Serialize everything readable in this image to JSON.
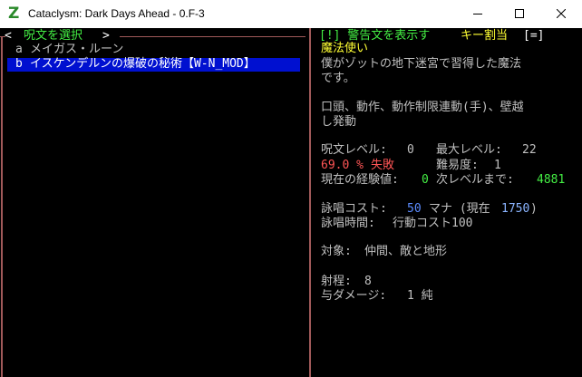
{
  "window": {
    "title": "Cataclysm: Dark Days Ahead - 0.F-3",
    "app_icon": "Z"
  },
  "left_panel": {
    "title": "呪文を選択",
    "open_marker": "<",
    "close_marker": ">",
    "spells": [
      {
        "key": "a",
        "name": "メイガス・ルーン",
        "selected": false
      },
      {
        "key": "b",
        "name": "イスケンデルンの爆破の秘術【W-N_MOD】",
        "selected": true
      }
    ]
  },
  "right_panel": {
    "toggle_label": "[!] 警告文を表示す",
    "keybind_label": "キー割当",
    "keybind_key": "[=]",
    "school": "魔法使い",
    "description": "僕がゾットの地下迷宮で習得した魔法です。",
    "description_lines": [
      "僕がゾットの地下迷宮で習得した魔法",
      "です。"
    ],
    "components_lines": [
      "口頭、動作、動作制限連動(手)、壁越",
      "し発動"
    ],
    "spell_level_label": "呪文レベル:",
    "spell_level": "0",
    "max_level_label": "最大レベル:",
    "max_level": "22",
    "failure_percent": "69.0 %",
    "failure_label": "失敗",
    "difficulty_label": "難易度:",
    "difficulty": "1",
    "exp_label": "現在の経験値:",
    "exp": "0",
    "next_label": "次レベルまで:",
    "next": "4881",
    "cost_label": "詠唱コスト:",
    "cost": "50",
    "cost_unit": "マナ (現在",
    "current_mana": "1750",
    "cost_close": ")",
    "cast_time_label": "詠唱時間:",
    "cast_time": "行動コスト100",
    "target_label": "対象:",
    "target": "仲間、敵と地形",
    "range_label": "射程:",
    "range": "8",
    "damage_label": "与ダメージ:",
    "damage": "1 純"
  },
  "colors": {
    "border": "#a15a5a",
    "selection": "#0010d0",
    "green": "#44ee44",
    "yellow": "#ffff33",
    "red": "#ff5555",
    "blue": "#5c8cff"
  }
}
